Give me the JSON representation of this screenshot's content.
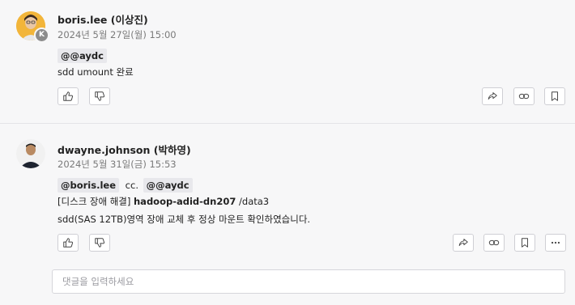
{
  "messages": [
    {
      "author": "boris.lee (이상진)",
      "date": "2024년 5월 27일(월) 15:00",
      "avatar_badge": "K",
      "mention": "@@aydc",
      "body": "sdd umount 완료"
    },
    {
      "author": "dwayne.johnson (박하영)",
      "date": "2024년 5월 31일(금) 15:53",
      "mention1": "@boris.lee",
      "cc": "cc.",
      "mention2": "@@aydc",
      "line1_prefix": "[디스크 장애 해결]",
      "line1_host": "hadoop-adid-dn207",
      "line1_suffix": "/data3",
      "line2": "sdd(SAS 12TB)영역 장애 교체 후 정상 마운트 확인하였습니다."
    }
  ],
  "comment_input": {
    "placeholder": "댓글을 입력하세요"
  },
  "colors": {
    "background": "#f7f7f8",
    "mention_bg": "#e8e8ec",
    "avatar1": "#f2b53a"
  },
  "icons": [
    "thumbs-up-icon",
    "thumbs-down-icon",
    "share-icon",
    "link-icon",
    "bookmark-icon",
    "more-icon"
  ]
}
